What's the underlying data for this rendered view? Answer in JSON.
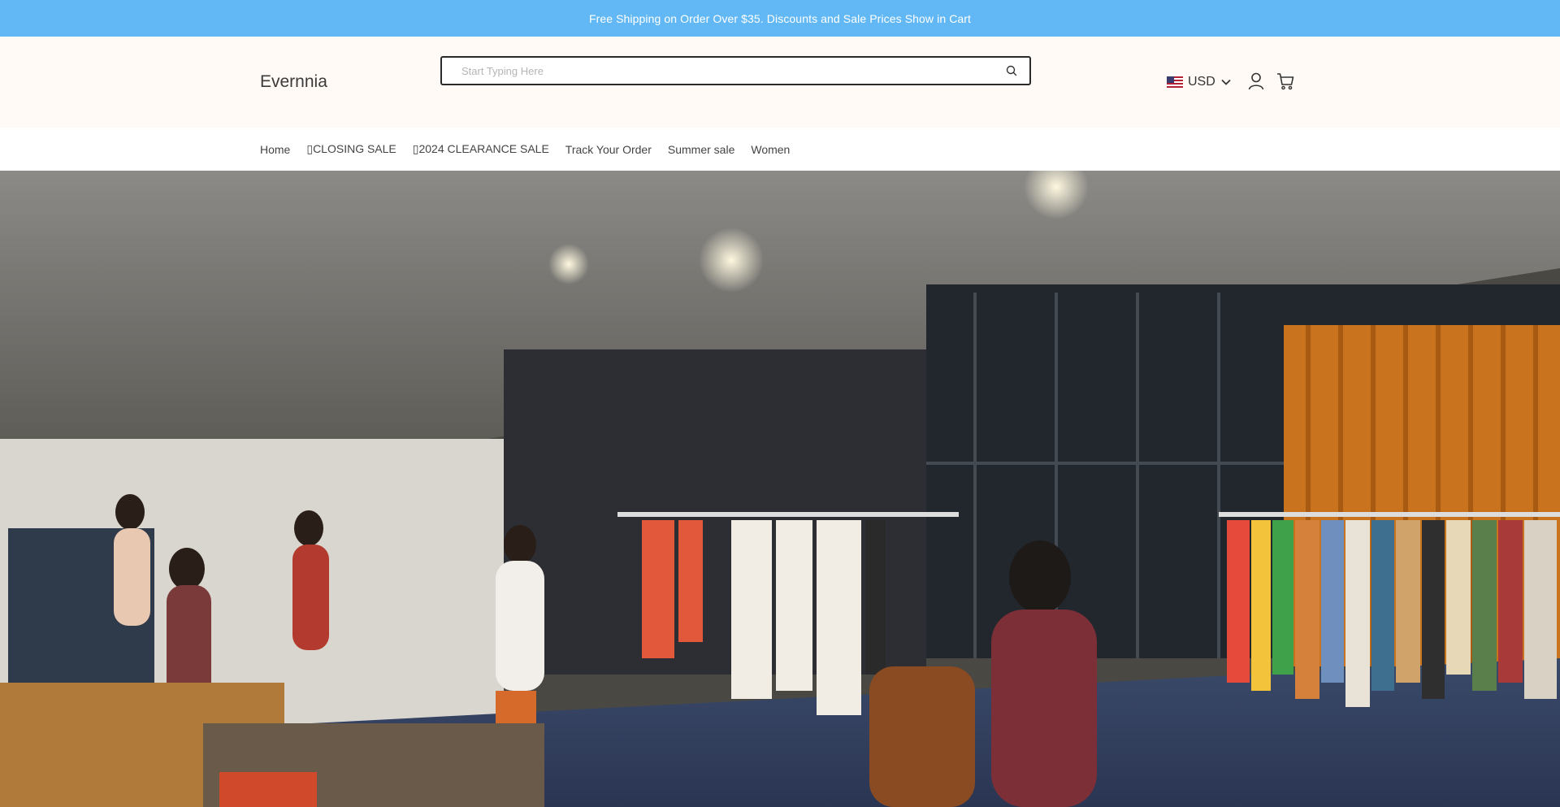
{
  "announcement": {
    "text": "Free Shipping on Order Over $35. Discounts and Sale Prices Show in Cart"
  },
  "header": {
    "logo": "Evernnia",
    "search_placeholder": "Start Typing Here",
    "currency": "USD",
    "icons": {
      "search": "search-icon",
      "currency_toggle": "chevron-down-icon",
      "account": "user-icon",
      "cart": "cart-icon",
      "flag": "us-flag-icon"
    }
  },
  "nav": {
    "items": [
      {
        "label": "Home"
      },
      {
        "label": "▯CLOSING SALE"
      },
      {
        "label": "▯2024 CLEARANCE SALE"
      },
      {
        "label": "Track Your Order"
      },
      {
        "label": "Summer sale"
      },
      {
        "label": "Women"
      }
    ]
  },
  "colors": {
    "announcement_bg": "#62b8f4",
    "header_bg": "#fffaf5",
    "text": "#333333"
  }
}
